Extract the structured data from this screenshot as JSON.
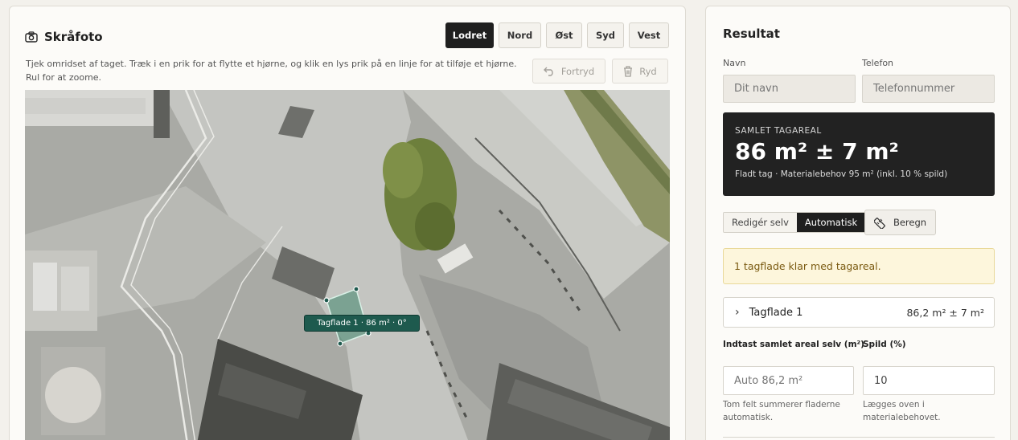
{
  "left": {
    "title": "Skråfoto",
    "view_buttons": [
      "Lodret",
      "Nord",
      "Øst",
      "Syd",
      "Vest"
    ],
    "active_view": "Lodret",
    "instructions": "Tjek omridset af taget. Træk i en prik for at flytte et hjørne, og klik en lys prik på en linje for at tilføje et hjørne. Rul for at zoome.",
    "undo_label": "Fortryd",
    "clear_label": "Ryd",
    "roof_label": "Tagflade 1 · 86 m² · 0°"
  },
  "right": {
    "title": "Resultat",
    "name_label": "Navn",
    "name_placeholder": "Dit navn",
    "phone_label": "Telefon",
    "phone_placeholder": "Telefonnummer",
    "summary_caption": "SAMLET TAGAREAL",
    "summary_value": "86 m² ± 7 m²",
    "summary_sub": "Fladt tag · Materialebehov 95 m² (inkl. 10 % spild)",
    "mode_manual": "Redigér selv",
    "mode_auto": "Automatisk",
    "calc_label": "Beregn",
    "notice": "1 tagflade klar med tagareal.",
    "facet_name": "Tagflade 1",
    "facet_value": "86,2 m² ± 7 m²",
    "area_label": "Indtast samlet areal selv (m²)",
    "area_placeholder": "Auto 86,2 m²",
    "waste_label": "Spild (%)",
    "waste_value": "10",
    "area_help": "Tom felt summerer fladerne automatisk.",
    "waste_help": "Lægges oven i materialebehovet."
  },
  "colors": {
    "accent_dark": "#1f1f1f",
    "roof_label_bg": "#1e5a4e",
    "notice_bg": "#fdf6dc",
    "notice_text": "#7a5a11"
  }
}
